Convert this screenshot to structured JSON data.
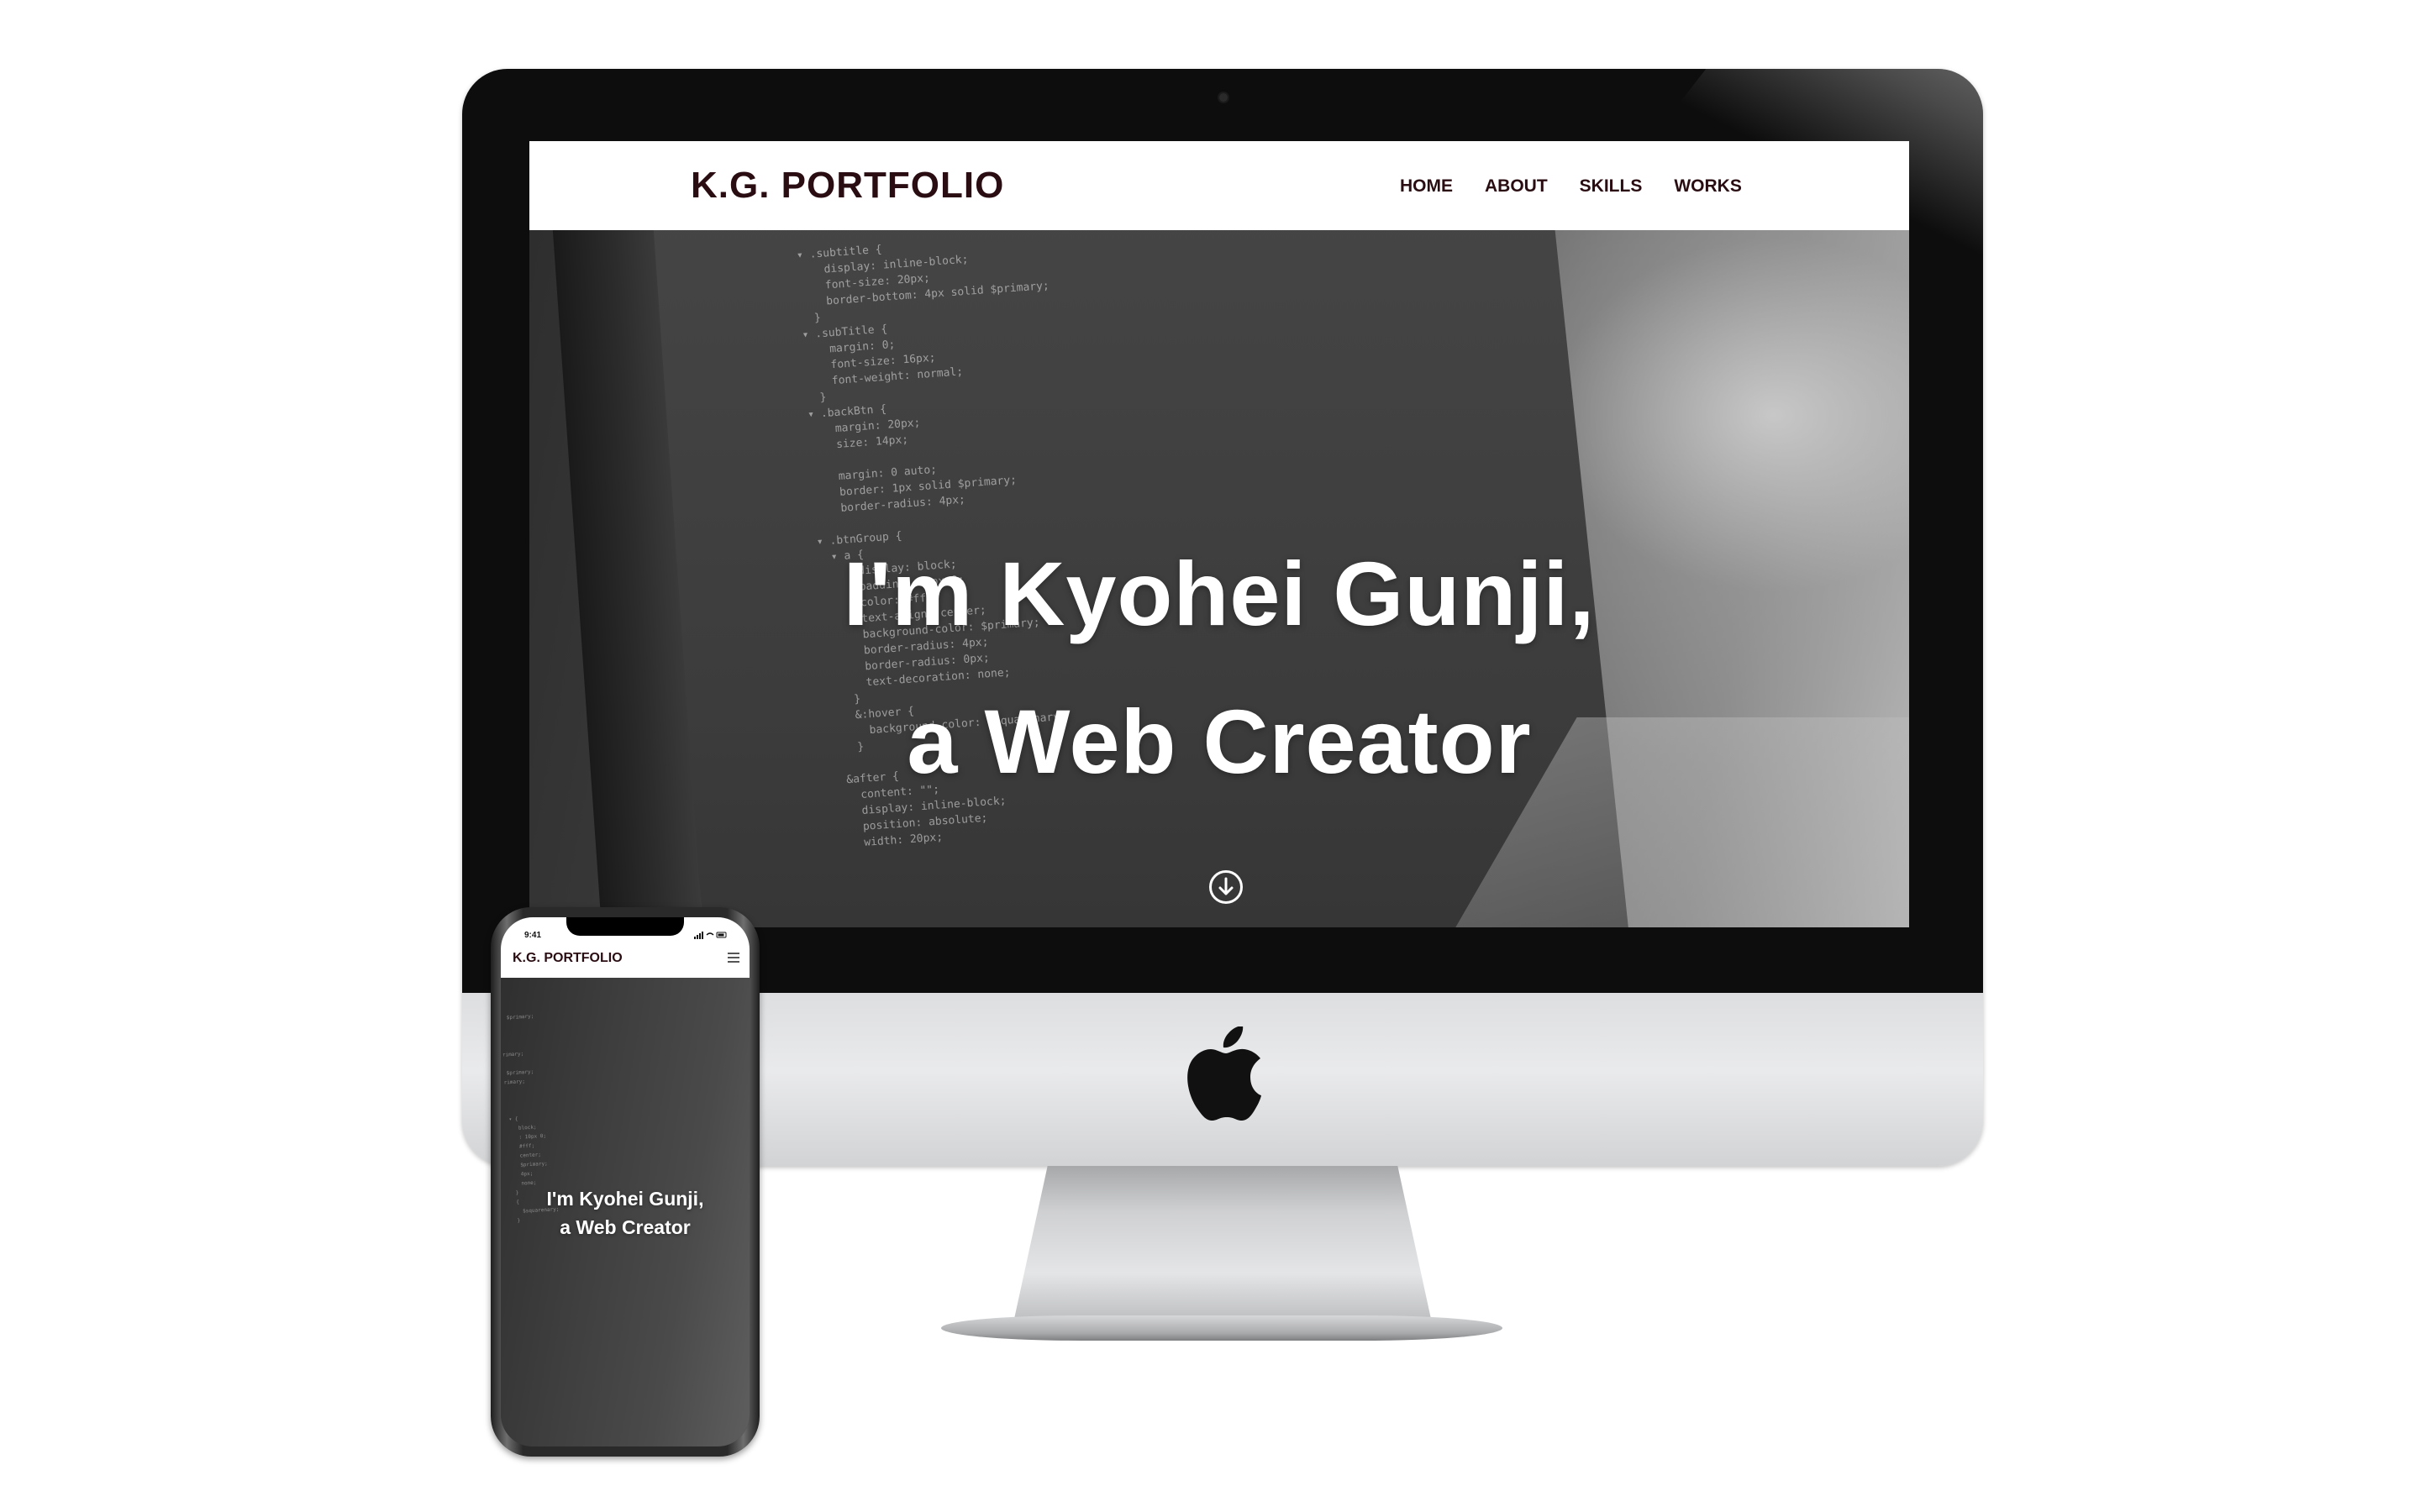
{
  "desktop": {
    "logo": "K.G. PORTFOLIO",
    "nav": [
      {
        "label": "HOME"
      },
      {
        "label": "ABOUT"
      },
      {
        "label": "SKILLS"
      },
      {
        "label": "WORKS"
      }
    ],
    "hero": {
      "line1": "I'm Kyohei Gunji,",
      "line2": "a Web Creator",
      "scroll_icon": "arrow-down-circle-icon"
    }
  },
  "mobile": {
    "status_time": "9:41",
    "logo": "K.G. PORTFOLIO",
    "menu_icon": "hamburger-menu-icon",
    "hero": {
      "line1": "I'm Kyohei Gunji,",
      "line2": "a Web Creator"
    }
  },
  "colors": {
    "brand_text": "#2a0d12",
    "header_bg": "#ffffff",
    "hero_text": "#ffffff"
  }
}
